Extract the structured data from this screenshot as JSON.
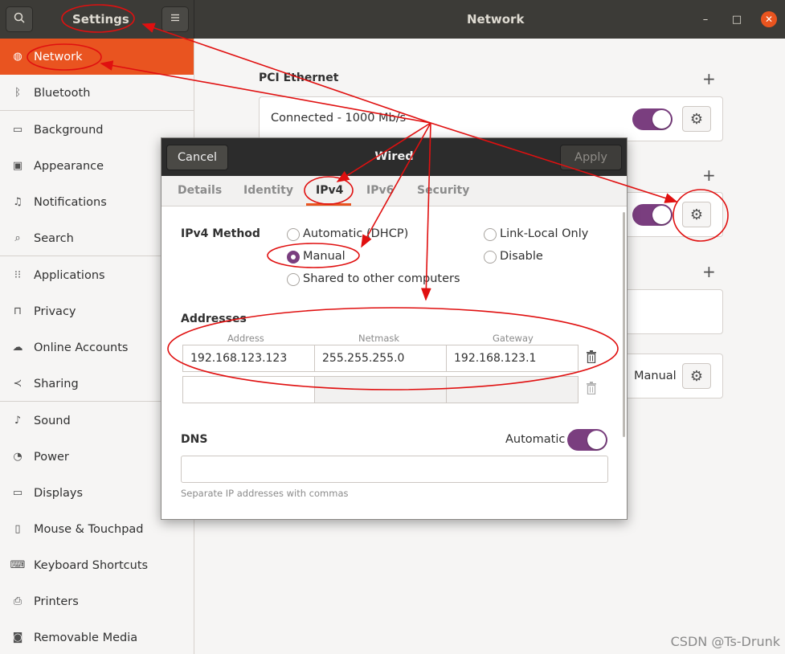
{
  "header": {
    "app_title": "Settings",
    "panel_title": "Network",
    "search_icon": "search-icon",
    "menu_icon": "hamburger-menu-icon",
    "controls": {
      "minimize": "–",
      "maximize": "□",
      "close": "✕"
    }
  },
  "sidebar": {
    "items": [
      {
        "label": "Network",
        "icon": "globe-icon",
        "active": true
      },
      {
        "label": "Bluetooth",
        "icon": "bluetooth-icon"
      },
      {
        "label": "Background",
        "icon": "monitor-icon"
      },
      {
        "label": "Appearance",
        "icon": "appearance-icon"
      },
      {
        "label": "Notifications",
        "icon": "bell-icon"
      },
      {
        "label": "Search",
        "icon": "search-icon"
      },
      {
        "label": "Applications",
        "icon": "grid-icon"
      },
      {
        "label": "Privacy",
        "icon": "lock-icon"
      },
      {
        "label": "Online Accounts",
        "icon": "cloud-icon"
      },
      {
        "label": "Sharing",
        "icon": "share-icon"
      },
      {
        "label": "Sound",
        "icon": "music-note-icon"
      },
      {
        "label": "Power",
        "icon": "power-icon"
      },
      {
        "label": "Displays",
        "icon": "display-icon"
      },
      {
        "label": "Mouse & Touchpad",
        "icon": "mouse-icon"
      },
      {
        "label": "Keyboard Shortcuts",
        "icon": "keyboard-icon"
      },
      {
        "label": "Printers",
        "icon": "printer-icon"
      },
      {
        "label": "Removable Media",
        "icon": "media-icon"
      }
    ]
  },
  "main": {
    "section_title": "PCI Ethernet",
    "wired_status": "Connected - 1000 Mb/s",
    "proxy_value": "Manual"
  },
  "dialog": {
    "title": "Wired",
    "cancel_label": "Cancel",
    "apply_label": "Apply",
    "tabs": [
      "Details",
      "Identity",
      "IPv4",
      "IPv6",
      "Security"
    ],
    "active_tab": "IPv4",
    "ipv4_method_label": "IPv4 Method",
    "methods": {
      "auto": "Automatic (DHCP)",
      "manual": "Manual",
      "shared": "Shared to other computers",
      "link_local": "Link-Local Only",
      "disable": "Disable"
    },
    "selected_method": "Manual",
    "addresses_label": "Addresses",
    "columns": [
      "Address",
      "Netmask",
      "Gateway"
    ],
    "rows": [
      [
        "192.168.123.123",
        "255.255.255.0",
        "192.168.123.1"
      ],
      [
        "",
        "",
        ""
      ]
    ],
    "dns_label": "DNS",
    "dns_auto_label": "Automatic",
    "dns_value": "",
    "dns_hint": "Separate IP addresses with commas"
  },
  "annotations": {
    "color": "#e01010",
    "watermark": "CSDN @Ts-Drunk"
  }
}
